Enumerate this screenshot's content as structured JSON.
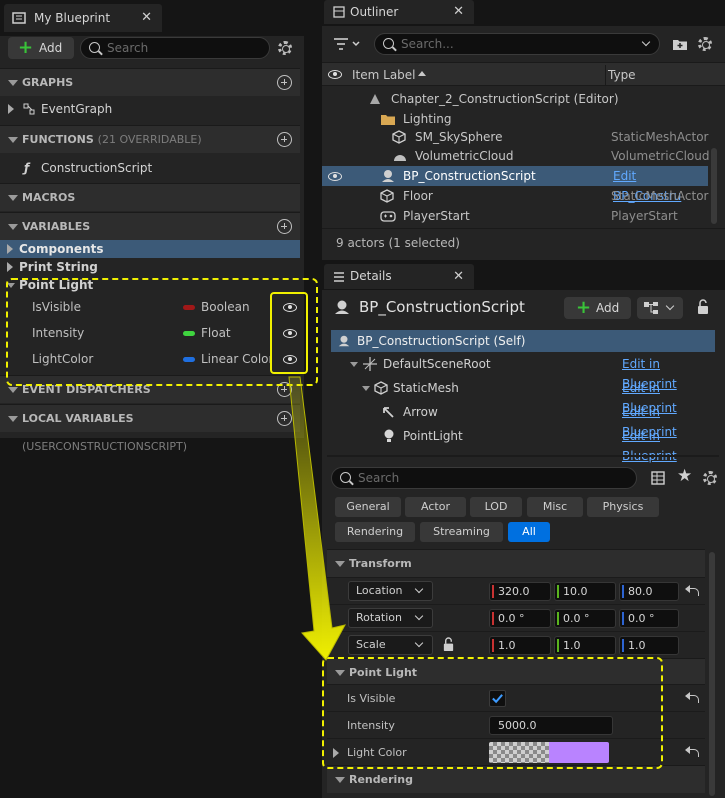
{
  "my_blueprint": {
    "tab_title": "My Blueprint",
    "add_label": "Add",
    "search_placeholder": "Search",
    "sections": {
      "graphs": "GRAPHS",
      "functions": "FUNCTIONS",
      "functions_sub": "(21 OVERRIDABLE)",
      "macros": "MACROS",
      "variables": "VARIABLES",
      "event_dispatchers": "EVENT DISPATCHERS",
      "local_variables": "LOCAL VARIABLES",
      "local_variables_sub": "(USERCONSTRUCTIONSCRIPT)"
    },
    "graphs_items": [
      "EventGraph"
    ],
    "function_items": [
      "ConstructionScript"
    ],
    "categories": [
      "Components",
      "Print String",
      "Point Light"
    ],
    "variables": [
      {
        "name": "IsVisible",
        "type": "Boolean",
        "color": "#a01818"
      },
      {
        "name": "Intensity",
        "type": "Float",
        "color": "#3fd43f"
      },
      {
        "name": "LightColor",
        "type": "Linear Color",
        "color": "#1f6fe0"
      }
    ]
  },
  "outliner": {
    "tab_title": "Outliner",
    "search_placeholder": "Search...",
    "col_label": "Item Label",
    "col_type": "Type",
    "rows": [
      {
        "label": "Chapter_2_ConstructionScript (Editor)",
        "type": ""
      },
      {
        "label": "Lighting",
        "type": ""
      },
      {
        "label": "SM_SkySphere",
        "type": "StaticMeshActor"
      },
      {
        "label": "VolumetricCloud",
        "type": "VolumetricCloud"
      },
      {
        "label": "BP_ConstructionScript",
        "type": "Edit BP_Constru"
      },
      {
        "label": "Floor",
        "type": "StaticMeshActor"
      },
      {
        "label": "PlayerStart",
        "type": "PlayerStart"
      }
    ],
    "footer": "9 actors (1 selected)"
  },
  "details": {
    "tab_title": "Details",
    "actor_name": "BP_ConstructionScript",
    "add_label": "Add",
    "components": [
      {
        "label": "BP_ConstructionScript (Self)",
        "link": ""
      },
      {
        "label": "DefaultSceneRoot",
        "link": "Edit in Blueprint"
      },
      {
        "label": "StaticMesh",
        "link": "Edit in Blueprint"
      },
      {
        "label": "Arrow",
        "link": "Edit in Blueprint"
      },
      {
        "label": "PointLight",
        "link": "Edit in Blueprint"
      }
    ],
    "search_placeholder": "Search",
    "category_tabs": [
      "General",
      "Actor",
      "LOD",
      "Misc",
      "Physics",
      "Rendering",
      "Streaming",
      "All"
    ],
    "transform": {
      "header": "Transform",
      "location": {
        "label": "Location",
        "x": "320.0",
        "y": "10.0",
        "z": "80.0"
      },
      "rotation": {
        "label": "Rotation",
        "x": "0.0 °",
        "y": "0.0 °",
        "z": "0.0 °"
      },
      "scale": {
        "label": "Scale",
        "x": "1.0",
        "y": "1.0",
        "z": "1.0"
      }
    },
    "point_light": {
      "header": "Point Light",
      "is_visible_label": "Is Visible",
      "is_visible": true,
      "intensity_label": "Intensity",
      "intensity": "5000.0",
      "light_color_label": "Light Color",
      "light_color": "#b983ff"
    },
    "rendering_header": "Rendering"
  },
  "colors": {
    "accent": "#0070e0",
    "highlight": "#f0f000",
    "selection": "#3c5a78"
  }
}
